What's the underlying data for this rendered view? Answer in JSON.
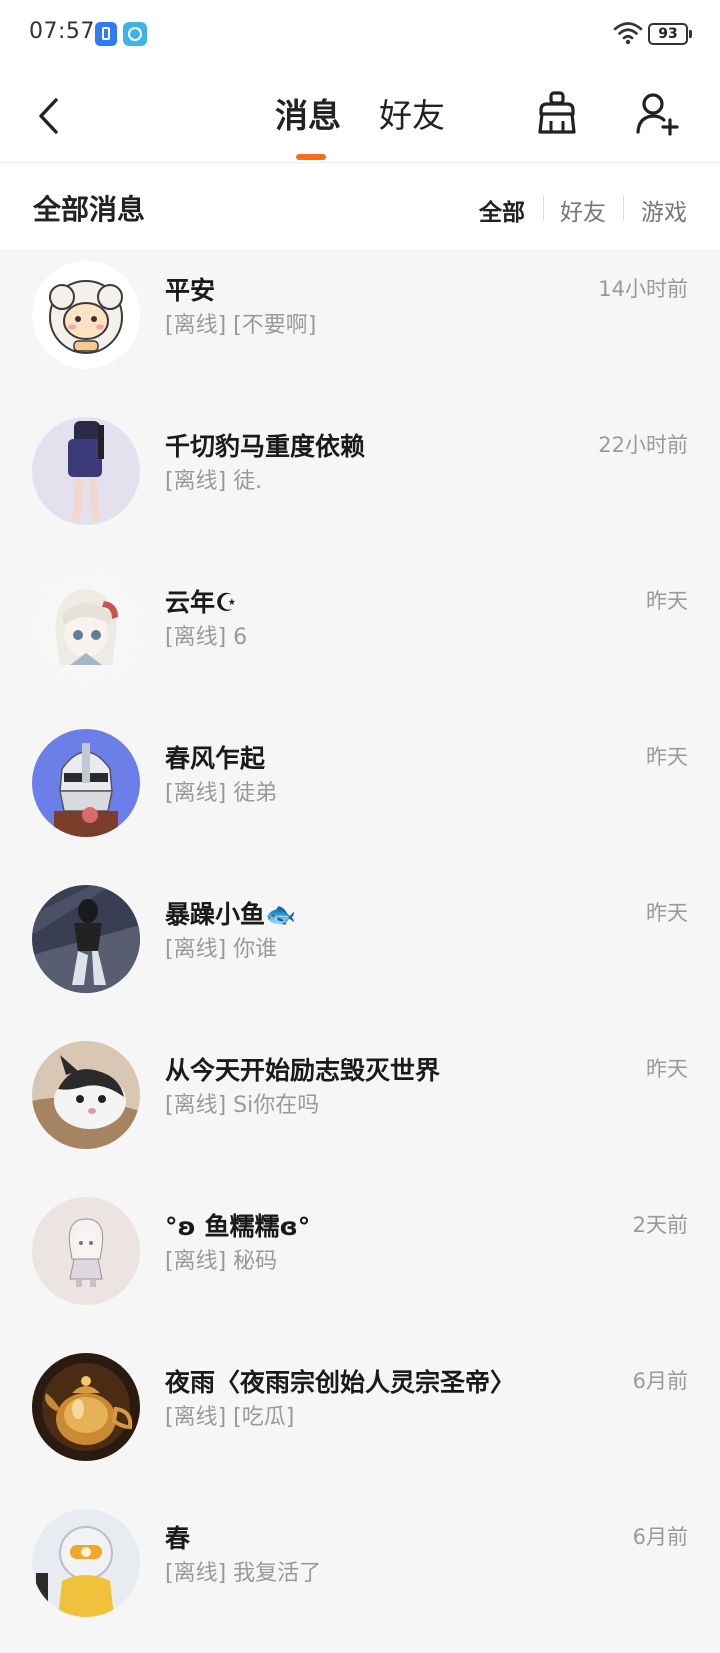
{
  "status_bar": {
    "time": "07:57",
    "battery": "93"
  },
  "header": {
    "tabs": [
      {
        "label": "消息",
        "active": true
      },
      {
        "label": "好友",
        "active": false
      }
    ],
    "accent_color": "#ff6a1a"
  },
  "section": {
    "title": "全部消息",
    "filters": [
      {
        "label": "全部",
        "active": true
      },
      {
        "label": "好友",
        "active": false
      },
      {
        "label": "游戏",
        "active": false
      }
    ]
  },
  "conversations": [
    {
      "name": "平安",
      "preview": "[离线] [不要啊]",
      "time": "14小时前",
      "avatar": "sheep-avatar"
    },
    {
      "name": "千切豹马重度依赖",
      "preview": "[离线] 徒.",
      "time": "22小时前",
      "avatar": "girl-avatar"
    },
    {
      "name": "云年☪",
      "preview": "[离线] 6",
      "time": "昨天",
      "avatar": "anime-avatar"
    },
    {
      "name": "春风乍起",
      "preview": "[离线] 徒弟",
      "time": "昨天",
      "avatar": "helmet-avatar"
    },
    {
      "name": "暴躁小鱼🐟",
      "preview": "[离线] 你谁",
      "time": "昨天",
      "avatar": "photo-avatar"
    },
    {
      "name": "从今天开始励志毁灭世界",
      "preview": "[离线] Si你在吗",
      "time": "昨天",
      "avatar": "cat-avatar"
    },
    {
      "name": "°ʚ 鱼糯糯ɞ°",
      "preview": "[离线] 秘码",
      "time": "2天前",
      "avatar": "chibi-avatar"
    },
    {
      "name": "夜雨〈夜雨宗创始人灵宗圣帝〉",
      "preview": "[离线] [吃瓜]",
      "time": "6月前",
      "avatar": "teapot-avatar"
    },
    {
      "name": "春",
      "preview": "[离线] 我复活了",
      "time": "6月前",
      "avatar": "robot-avatar"
    }
  ]
}
